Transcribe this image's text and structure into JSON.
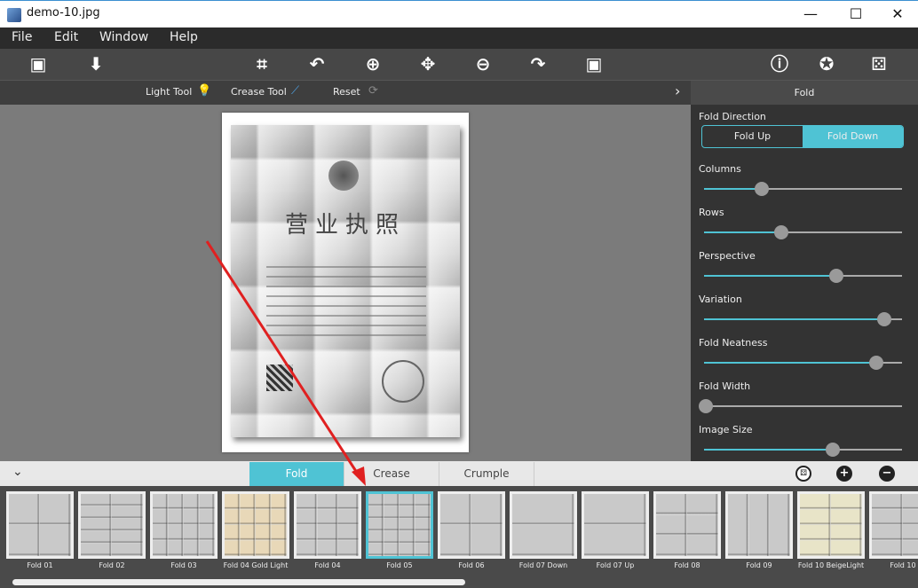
{
  "window": {
    "title": "demo-10.jpg",
    "minimize": "—",
    "maximize": "☐",
    "close": "✕"
  },
  "menu": [
    "File",
    "Edit",
    "Window",
    "Help"
  ],
  "toolbar": {
    "icons": [
      "open-image-icon",
      "save-icon",
      "crop-icon",
      "undo-icon",
      "zoom-in-icon",
      "move-icon",
      "zoom-out-icon",
      "redo-icon",
      "fit-image-icon",
      "info-icon",
      "settings-icon",
      "random-dice-icon"
    ]
  },
  "subtoolbar": {
    "light_tool": "Light Tool",
    "crease_tool": "Crease Tool",
    "reset": "Reset",
    "expand": "›"
  },
  "document": {
    "title": "营业执照"
  },
  "panel": {
    "title": "Fold",
    "fold_direction_label": "Fold Direction",
    "fold_up": "Fold Up",
    "fold_down": "Fold Down",
    "selected_direction": "Fold Down",
    "sliders": [
      {
        "label": "Columns",
        "value": 0.29
      },
      {
        "label": "Rows",
        "value": 0.39
      },
      {
        "label": "Perspective",
        "value": 0.67
      },
      {
        "label": "Variation",
        "value": 0.91
      },
      {
        "label": "Fold Neatness",
        "value": 0.87
      },
      {
        "label": "Fold Width",
        "value": 0.01
      },
      {
        "label": "Image Size",
        "value": 0.65
      }
    ]
  },
  "bottom": {
    "collapse": "⌄",
    "tabs": [
      "Fold",
      "Crease",
      "Crumple"
    ],
    "active_tab": "Fold",
    "presets": [
      {
        "label": "Fold 01"
      },
      {
        "label": "Fold 02"
      },
      {
        "label": "Fold 03"
      },
      {
        "label": "Fold 04 Gold Light",
        "tint": "#e8d8b8"
      },
      {
        "label": "Fold 04"
      },
      {
        "label": "Fold 05",
        "selected": true
      },
      {
        "label": "Fold 06"
      },
      {
        "label": "Fold 07 Down"
      },
      {
        "label": "Fold 07 Up"
      },
      {
        "label": "Fold 08"
      },
      {
        "label": "Fold 09"
      },
      {
        "label": "Fold 10 BeigeLight",
        "tint": "#e8e4c8"
      },
      {
        "label": "Fold 10"
      }
    ]
  },
  "colors": {
    "accent": "#4fc3d4",
    "annotation_arrow": "#e02020"
  }
}
